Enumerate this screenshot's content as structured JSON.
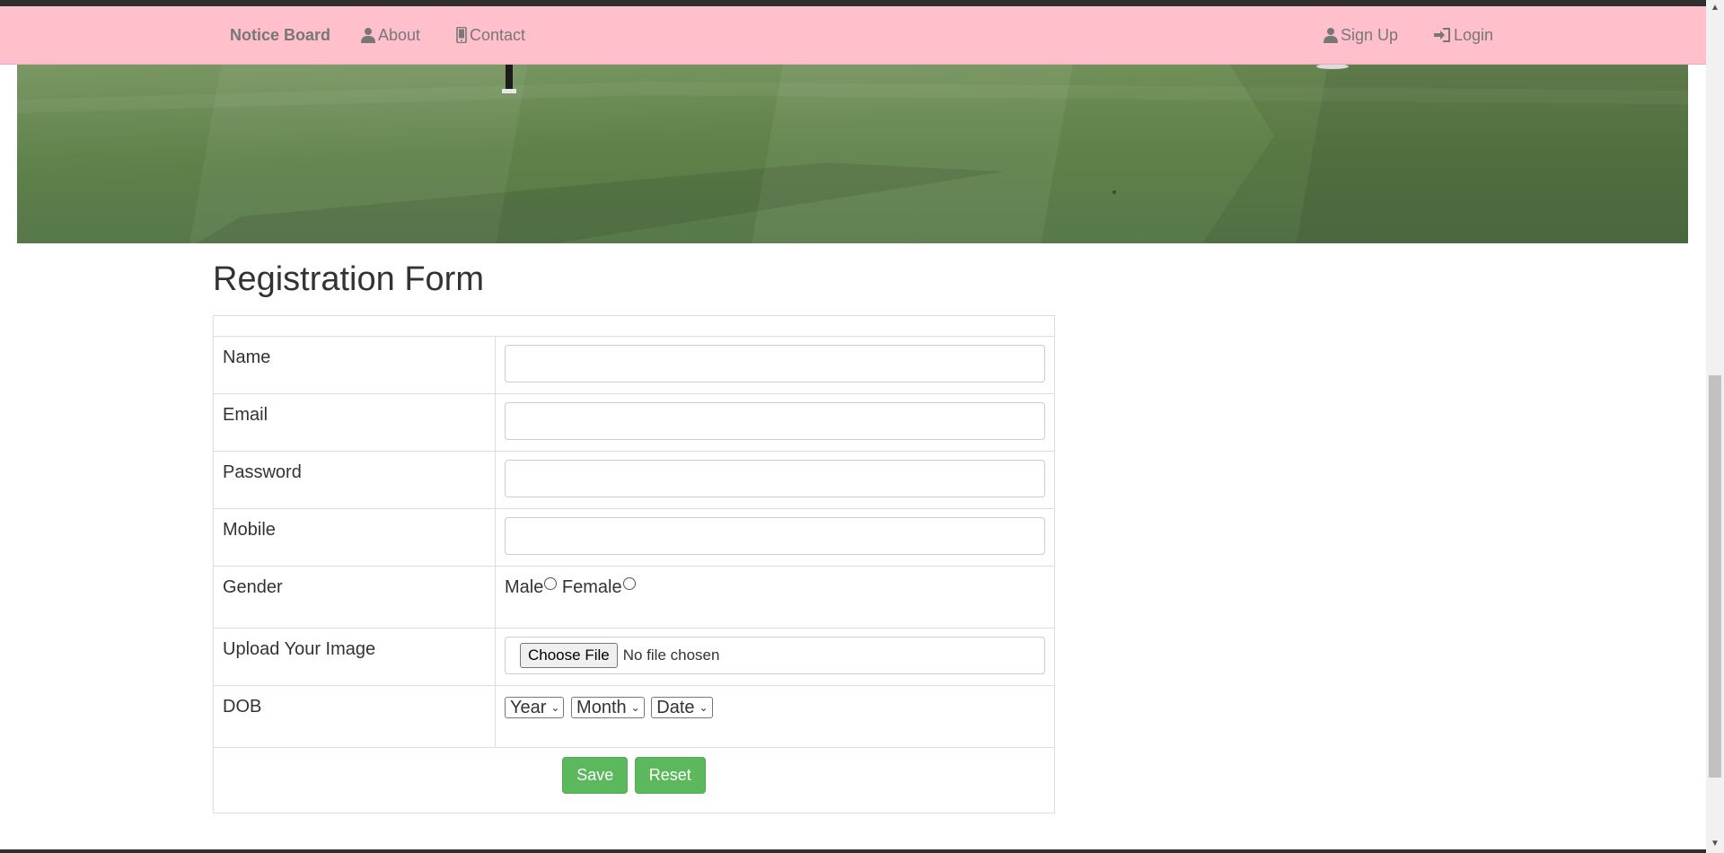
{
  "navbar": {
    "brand": "Notice Board",
    "about": "About",
    "contact": "Contact",
    "signup": "Sign Up",
    "login": "Login"
  },
  "form": {
    "title": "Registration Form",
    "name_label": "Name",
    "email_label": "Email",
    "password_label": "Password",
    "mobile_label": "Mobile",
    "gender_label": "Gender",
    "gender_male": "Male",
    "gender_female": "Female",
    "upload_label": "Upload Your Image",
    "choose_file": "Choose File",
    "file_status": "No file chosen",
    "dob_label": "DOB",
    "dob_year": "Year",
    "dob_month": "Month",
    "dob_date": "Date",
    "save": "Save",
    "reset": "Reset"
  },
  "colors": {
    "navbar_bg": "#ffc0cb",
    "button_green": "#5cb85c"
  },
  "icons": [
    "user-icon",
    "mobile-phone-icon",
    "login-icon",
    "scroll-up-icon",
    "scroll-down-icon"
  ]
}
